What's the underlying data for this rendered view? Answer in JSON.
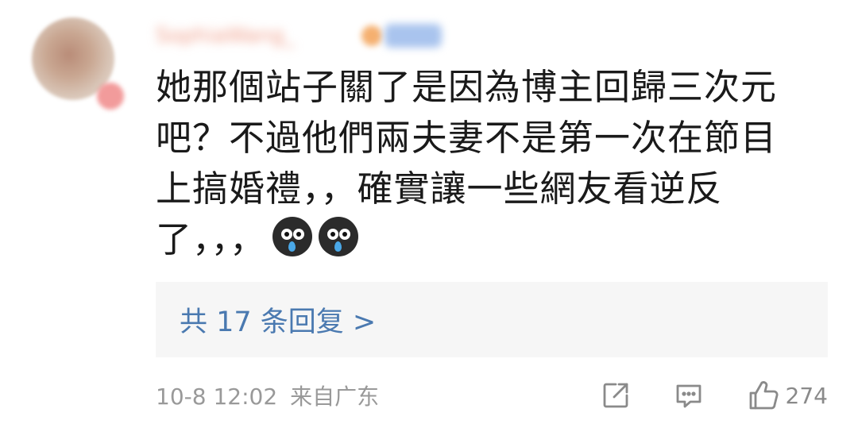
{
  "comment": {
    "username": "SophiaWang_",
    "lines": [
      "她那個站子關了是因為博主回歸三次元",
      "吧？不過他們兩夫妻不是第一次在節目",
      "上搞婚禮，，確實讓一些網友看逆反",
      "了，，，"
    ],
    "emojis": [
      "crying-emoji",
      "crying-emoji"
    ]
  },
  "replies": {
    "label": "共 17 条回复 >"
  },
  "meta": {
    "time": "10-8 12:02",
    "location": "来自广东"
  },
  "actions": {
    "like_count": "274",
    "icons": [
      "share-icon",
      "comment-icon",
      "like-icon"
    ]
  },
  "colors": {
    "link": "#4a79b0",
    "meta": "#999999",
    "text": "#1a1a1a",
    "reply_bg": "#f6f6f6"
  }
}
